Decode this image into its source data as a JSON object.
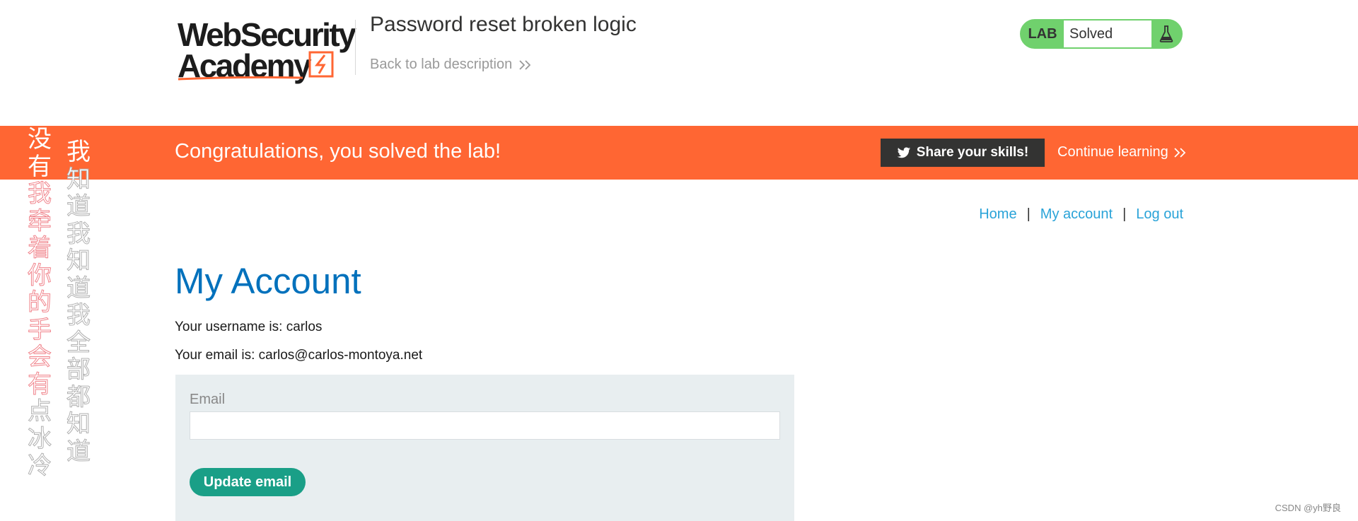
{
  "header": {
    "logo_line1": "WebSecurity",
    "logo_line2": "Academy",
    "lab_title": "Password reset broken logic",
    "back_link": "Back to lab description",
    "status_label": "LAB",
    "status_value": "Solved",
    "status_icon": "flask-icon"
  },
  "banner": {
    "message": "Congratulations, you solved the lab!",
    "share_label": "Share your skills!",
    "share_icon": "twitter-bird-icon",
    "continue_label": "Continue learning",
    "color": "#ff6633"
  },
  "nav": {
    "home": "Home",
    "account": "My account",
    "logout": "Log out",
    "separator": "|"
  },
  "main": {
    "title": "My Account",
    "username_text": "Your username is: carlos",
    "email_text": "Your email is: carlos@carlos-montoya.net",
    "email_label": "Email",
    "email_value": "",
    "update_button": "Update email"
  },
  "overlay": {
    "left_column": [
      "没",
      "有",
      "我",
      "牵",
      "着",
      "你",
      "的",
      "手",
      "会",
      "有",
      "点",
      "冰",
      "冷"
    ],
    "right_column": [
      "我",
      "知",
      "道",
      "我",
      "知",
      "道",
      "我",
      "全",
      "部",
      "都",
      "知",
      "道"
    ]
  },
  "watermark": "CSDN @yh野良",
  "colors": {
    "accent_orange": "#ff6633",
    "title_blue": "#0071bc",
    "link_blue": "#29a3d8",
    "solved_green": "#70d16d",
    "button_teal": "#1a9f87"
  }
}
